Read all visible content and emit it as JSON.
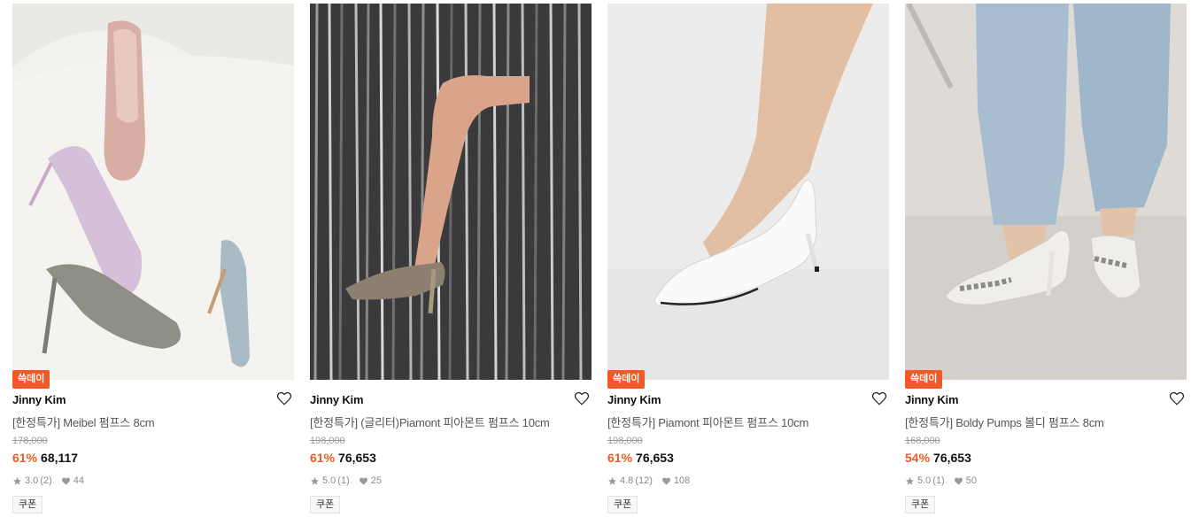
{
  "products": [
    {
      "badge": "쓱데이",
      "brand": "Jinny Kim",
      "name": "[한정특가] Meibel 펌프스 8cm",
      "original_price": "178,000",
      "discount": "61%",
      "price": "68,117",
      "rating": "3.0",
      "reviews": "(2)",
      "likes": "44",
      "coupon": "쿠폰"
    },
    {
      "badge": "",
      "brand": "Jinny Kim",
      "name": "[한정특가] (글리터)Piamont 피아몬트 펌프스 10cm",
      "original_price": "198,000",
      "discount": "61%",
      "price": "76,653",
      "rating": "5.0",
      "reviews": "(1)",
      "likes": "25",
      "coupon": "쿠폰"
    },
    {
      "badge": "쓱데이",
      "brand": "Jinny Kim",
      "name": "[한정특가] Piamont 피아몬트 펌프스 10cm",
      "original_price": "198,000",
      "discount": "61%",
      "price": "76,653",
      "rating": "4.8",
      "reviews": "(12)",
      "likes": "108",
      "coupon": "쿠폰"
    },
    {
      "badge": "쓱데이",
      "brand": "Jinny Kim",
      "name": "[한정특가] Boldy Pumps 볼디 펌프스 8cm",
      "original_price": "168,000",
      "discount": "54%",
      "price": "76,653",
      "rating": "5.0",
      "reviews": "(1)",
      "likes": "50",
      "coupon": "쿠폰"
    }
  ],
  "colors": {
    "accent": "#f05a28",
    "text": "#111111",
    "muted": "#9a9a9a"
  },
  "icons": {
    "wishlist": "heart-outline-icon",
    "rating": "star-icon",
    "likes": "heart-filled-icon"
  }
}
